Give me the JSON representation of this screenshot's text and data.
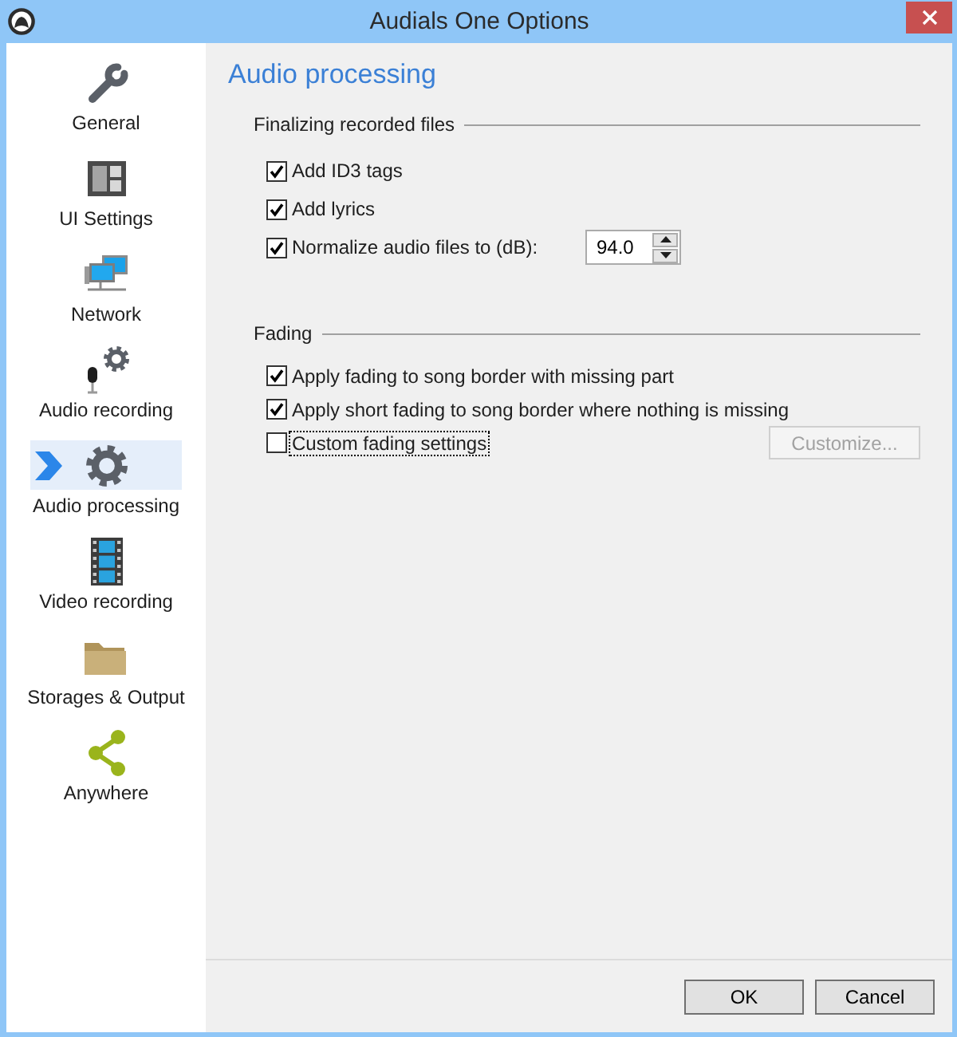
{
  "window": {
    "title": "Audials One Options"
  },
  "sidebar": {
    "items": [
      {
        "label": "General",
        "selected": false
      },
      {
        "label": "UI Settings",
        "selected": false
      },
      {
        "label": "Network",
        "selected": false
      },
      {
        "label": "Audio recording",
        "selected": false
      },
      {
        "label": "Audio processing",
        "selected": true
      },
      {
        "label": "Video recording",
        "selected": false
      },
      {
        "label": "Storages & Output",
        "selected": false
      },
      {
        "label": "Anywhere",
        "selected": false
      }
    ]
  },
  "page": {
    "title": "Audio processing",
    "groups": [
      {
        "title": "Finalizing recorded files",
        "options": [
          {
            "kind": "checkbox",
            "label": "Add ID3 tags",
            "checked": true,
            "focused": false
          },
          {
            "kind": "checkbox",
            "label": "Add lyrics",
            "checked": true,
            "focused": false
          },
          {
            "kind": "checkbox-spin",
            "label": "Normalize audio files to (dB):",
            "checked": true,
            "focused": false,
            "value": "94.0"
          }
        ]
      },
      {
        "title": "Fading",
        "options": [
          {
            "kind": "checkbox",
            "label": "Apply fading to song border with missing part",
            "checked": true,
            "focused": false
          },
          {
            "kind": "checkbox",
            "label": "Apply short fading to song border where nothing is missing",
            "checked": true,
            "focused": false
          },
          {
            "kind": "checkbox-button",
            "label": "Custom fading settings",
            "checked": false,
            "focused": true,
            "button": {
              "label": "Customize...",
              "disabled": true
            }
          }
        ]
      }
    ]
  },
  "buttons": [
    {
      "label": "OK"
    },
    {
      "label": "Cancel"
    }
  ]
}
